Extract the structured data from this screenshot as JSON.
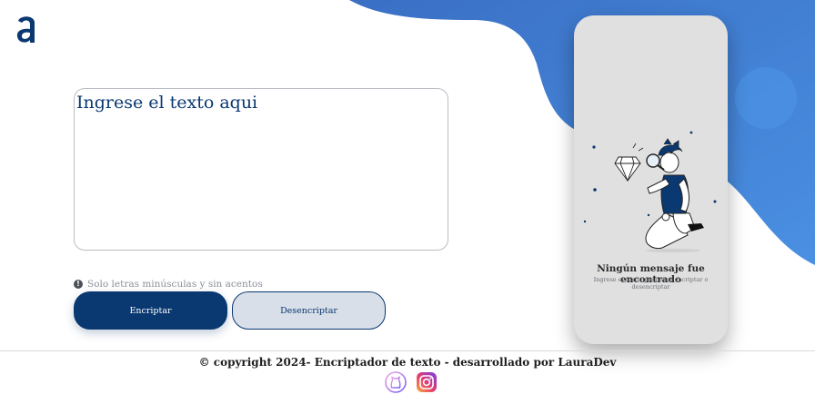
{
  "app": {
    "logo_icon": "alura-a-logo"
  },
  "input": {
    "placeholder": "Ingrese el texto aqui",
    "value": ""
  },
  "hint": {
    "icon": "exclamation-circle-icon",
    "text": "Solo letras minúsculas y sin acentos"
  },
  "buttons": {
    "encrypt_label": "Encriptar",
    "decrypt_label": "Desencriptar"
  },
  "output": {
    "illustration": "person-with-magnifying-glass-diamond",
    "title": "Ningún mensaje fue encontrado",
    "subtitle": "Ingrese el texto que desea encriptar o desencriptar"
  },
  "footer": {
    "copyright": "© copyright 2024- Encriptador de texto - desarrollado por LauraDev",
    "social": [
      "github-icon",
      "instagram-icon"
    ]
  },
  "colors": {
    "primary": "#0a3871",
    "blob": "#3f7fd9",
    "panel": "#e0e0e0"
  }
}
